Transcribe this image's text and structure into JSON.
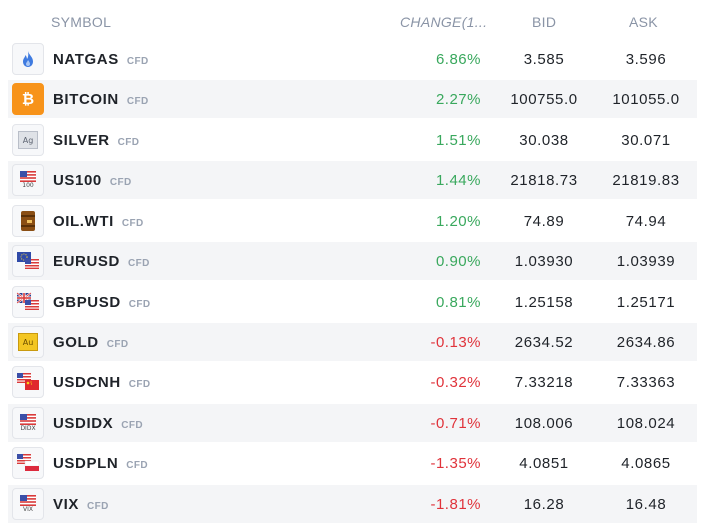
{
  "headers": {
    "symbol": "SYMBOL",
    "change": "CHANGE(1...",
    "bid": "BID",
    "ask": "ASK"
  },
  "colors": {
    "positive": "#39a85d",
    "negative": "#e0333b",
    "bitcoin": "#f7931a",
    "gold": "#f3c623"
  },
  "rows": [
    {
      "symbol": "NATGAS",
      "tag": "CFD",
      "change": "6.86%",
      "bid": "3.585",
      "ask": "3.596",
      "icon": "flame-icon"
    },
    {
      "symbol": "BITCOIN",
      "tag": "CFD",
      "change": "2.27%",
      "bid": "100755.0",
      "ask": "101055.0",
      "icon": "bitcoin-icon"
    },
    {
      "symbol": "SILVER",
      "tag": "CFD",
      "change": "1.51%",
      "bid": "30.038",
      "ask": "30.071",
      "icon": "silver-icon",
      "icon_text": "Ag"
    },
    {
      "symbol": "US100",
      "tag": "CFD",
      "change": "1.44%",
      "bid": "21818.73",
      "ask": "21819.83",
      "icon": "us-flag-icon",
      "icon_text": "100"
    },
    {
      "symbol": "OIL.WTI",
      "tag": "CFD",
      "change": "1.20%",
      "bid": "74.89",
      "ask": "74.94",
      "icon": "oil-barrel-icon"
    },
    {
      "symbol": "EURUSD",
      "tag": "CFD",
      "change": "0.90%",
      "bid": "1.03930",
      "ask": "1.03939",
      "icon": "eu-us-flags-icon"
    },
    {
      "symbol": "GBPUSD",
      "tag": "CFD",
      "change": "0.81%",
      "bid": "1.25158",
      "ask": "1.25171",
      "icon": "uk-us-flags-icon"
    },
    {
      "symbol": "GOLD",
      "tag": "CFD",
      "change": "-0.13%",
      "bid": "2634.52",
      "ask": "2634.86",
      "icon": "gold-icon",
      "icon_text": "Au"
    },
    {
      "symbol": "USDCNH",
      "tag": "CFD",
      "change": "-0.32%",
      "bid": "7.33218",
      "ask": "7.33363",
      "icon": "us-cn-flags-icon"
    },
    {
      "symbol": "USDIDX",
      "tag": "CFD",
      "change": "-0.71%",
      "bid": "108.006",
      "ask": "108.024",
      "icon": "us-flag-icon",
      "icon_text": "DIDX"
    },
    {
      "symbol": "USDPLN",
      "tag": "CFD",
      "change": "-1.35%",
      "bid": "4.0851",
      "ask": "4.0865",
      "icon": "us-pl-flags-icon"
    },
    {
      "symbol": "VIX",
      "tag": "CFD",
      "change": "-1.81%",
      "bid": "16.28",
      "ask": "16.48",
      "icon": "us-flag-icon",
      "icon_text": "VIX"
    }
  ]
}
